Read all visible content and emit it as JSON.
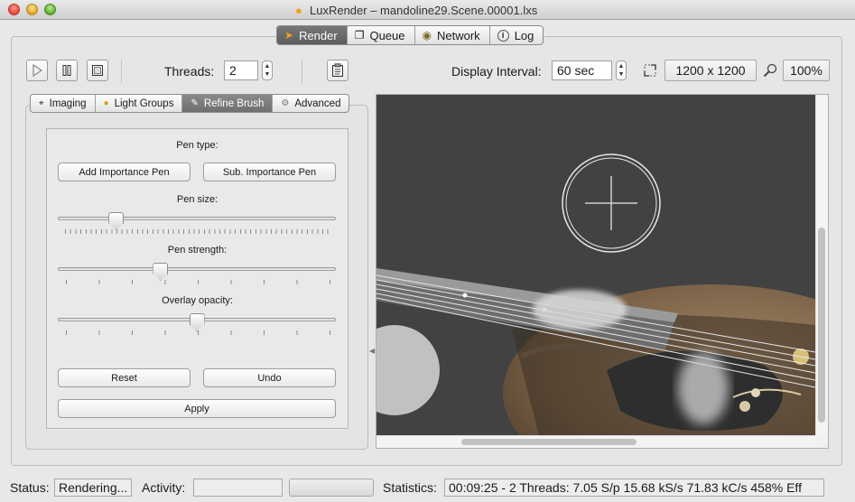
{
  "window": {
    "title": "LuxRender – mandoline29.Scene.00001.lxs"
  },
  "top_tabs": [
    {
      "label": "Render",
      "icon": "luxrender-icon",
      "active": true
    },
    {
      "label": "Queue",
      "icon": "queue-icon",
      "active": false
    },
    {
      "label": "Network",
      "icon": "network-icon",
      "active": false
    },
    {
      "label": "Log",
      "icon": "info-icon",
      "active": false
    }
  ],
  "toolbar": {
    "threads_label": "Threads:",
    "threads_value": "2",
    "display_interval_label": "Display Interval:",
    "display_interval_value": "60 sec",
    "resolution": "1200 x 1200",
    "zoom": "100%"
  },
  "settings_tabs": [
    {
      "label": "Imaging",
      "icon": "imaging-icon",
      "active": false
    },
    {
      "label": "Light Groups",
      "icon": "light-groups-icon",
      "active": false
    },
    {
      "label": "Refine Brush",
      "icon": "brush-icon",
      "active": true
    },
    {
      "label": "Advanced",
      "icon": "gear-icon",
      "active": false
    }
  ],
  "refine_brush": {
    "pen_type_label": "Pen type:",
    "add_importance_pen": "Add Importance Pen",
    "sub_importance_pen": "Sub. Importance Pen",
    "pen_size_label": "Pen size:",
    "pen_size": 0.21,
    "pen_strength_label": "Pen strength:",
    "pen_strength": 0.37,
    "overlay_opacity_label": "Overlay opacity:",
    "overlay_opacity": 0.5,
    "reset": "Reset",
    "undo": "Undo",
    "apply": "Apply"
  },
  "status_bar": {
    "status_label": "Status:",
    "status_value": "Rendering...",
    "activity_label": "Activity:",
    "activity_value": "",
    "statistics_label": "Statistics:",
    "statistics_value": "00:09:25 - 2 Threads: 7.05 S/p 15.68 kS/s 71.83 kC/s 458% Eff"
  }
}
